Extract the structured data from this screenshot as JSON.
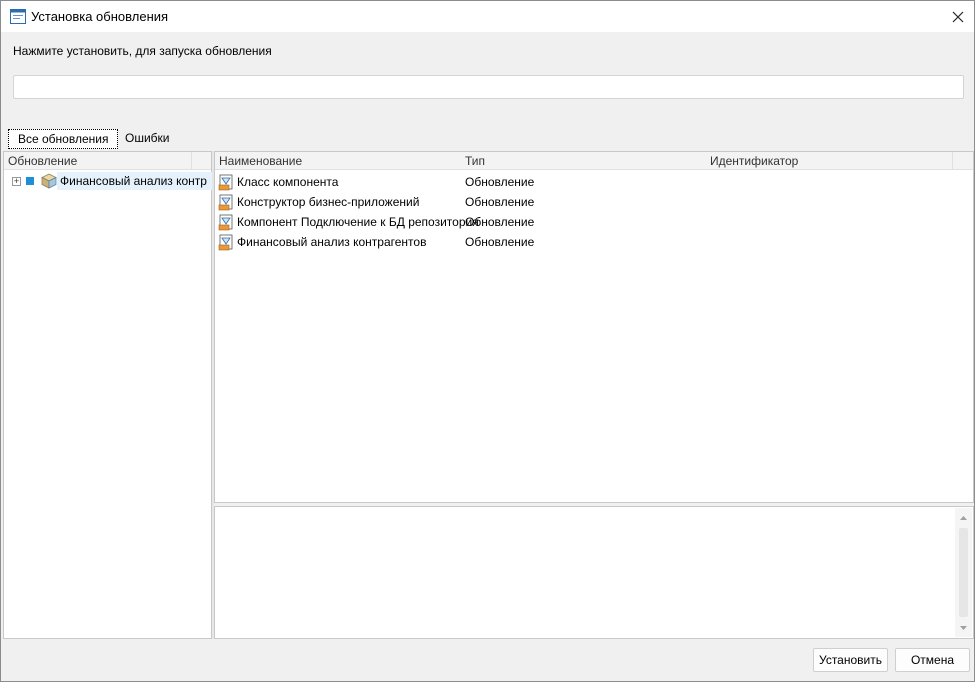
{
  "window": {
    "title": "Установка обновления"
  },
  "prompt": "Нажмите установить, для запуска обновления",
  "progress": {
    "value": 0
  },
  "tabs": [
    {
      "label": "Все обновления",
      "active": true
    },
    {
      "label": "Ошибки",
      "active": false
    }
  ],
  "tree": {
    "header": "Обновление",
    "items": [
      {
        "label": "Финансовый анализ контр",
        "icon": "package-cube-icon",
        "status_color": "#1e8fd6"
      }
    ]
  },
  "list": {
    "columns": [
      "Наименование",
      "Тип",
      "Идентификатор"
    ],
    "rows": [
      {
        "name": "Класс компонента",
        "type": "Обновление",
        "id": ""
      },
      {
        "name": "Конструктор бизнес-приложений",
        "type": "Обновление",
        "id": ""
      },
      {
        "name": "Компонент Подключение к БД репозитория",
        "type": "Обновление",
        "id": ""
      },
      {
        "name": "Финансовый анализ контрагентов",
        "type": "Обновление",
        "id": ""
      }
    ]
  },
  "buttons": {
    "install": "Установить",
    "cancel": "Отмена"
  },
  "colors": {
    "accent": "#1e8fd6",
    "selection": "#e5f1fb"
  }
}
